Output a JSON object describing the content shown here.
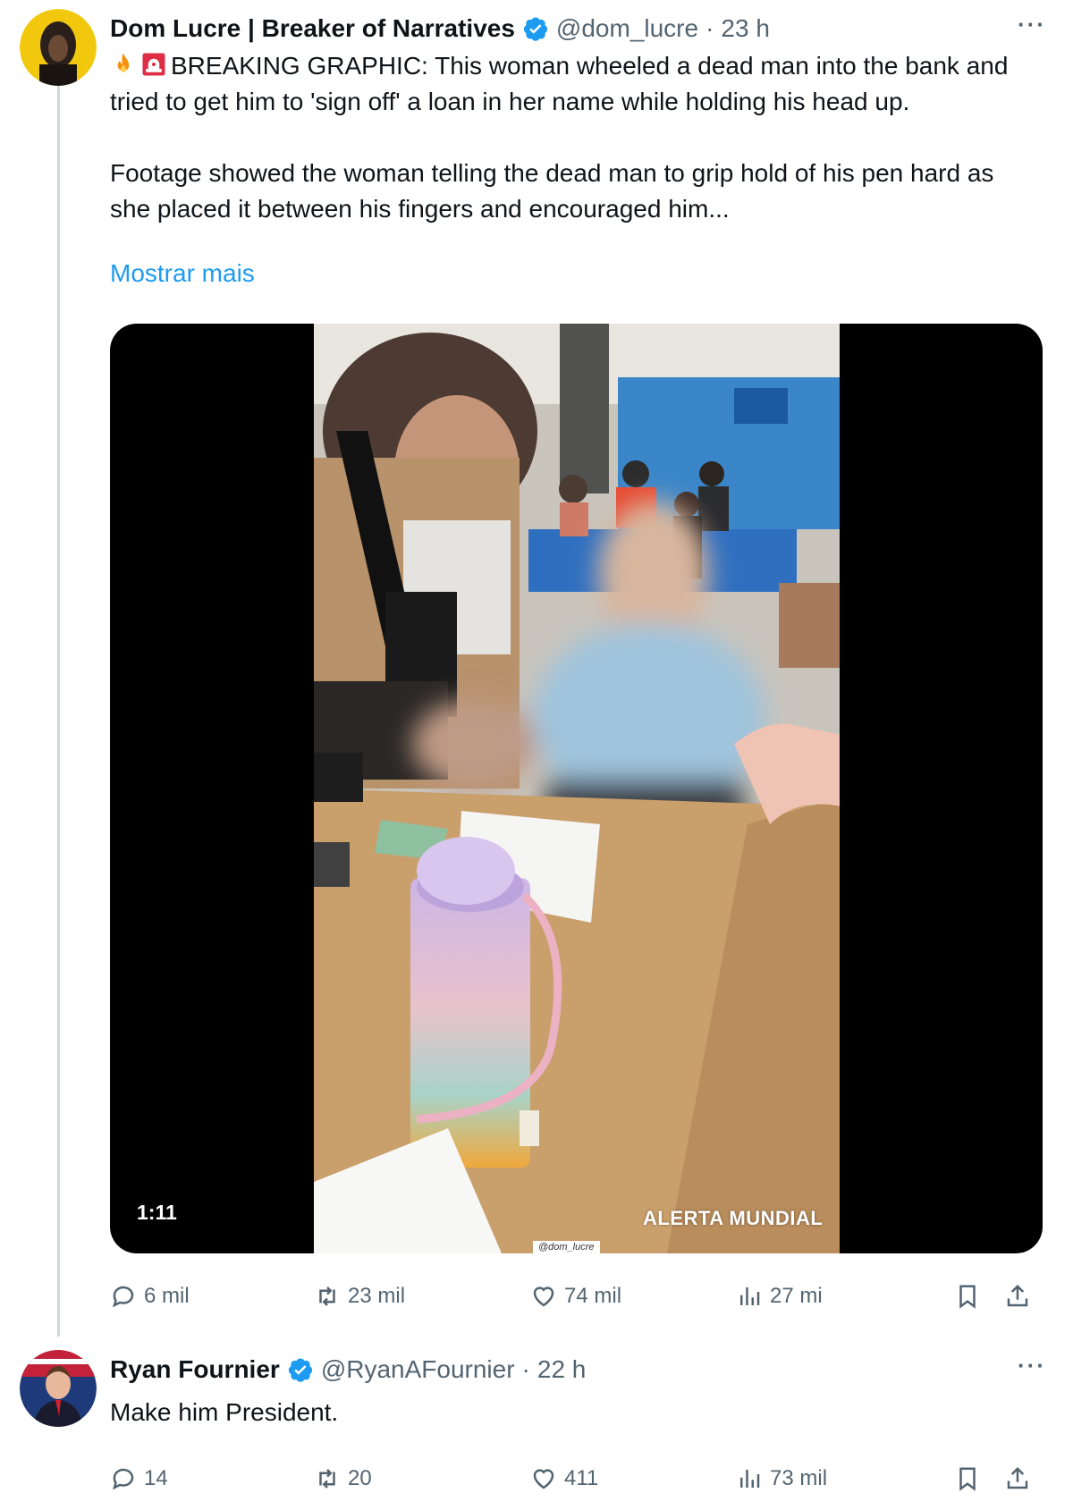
{
  "colors": {
    "accent": "#1d9bf0",
    "text_primary": "#0f1419",
    "text_secondary": "#536471",
    "thread_line": "#cfd9de"
  },
  "tweets": [
    {
      "display_name": "Dom Lucre | Breaker of Narratives",
      "handle": "@dom_lucre",
      "separator": "·",
      "time": "23 h",
      "verified_icon": "verified-badge-icon",
      "more_label": "···",
      "emoji_icons": [
        "fire-icon",
        "siren-icon"
      ],
      "paragraphs": [
        "BREAKING GRAPHIC: This woman wheeled a dead man into the bank and tried to get him to 'sign off' a loan in her name while holding his head up.",
        "Footage showed the woman telling the dead man to grip hold of his pen hard as she placed it between his fingers and encouraged him..."
      ],
      "show_more": "Mostrar mais",
      "media": {
        "duration": "1:11",
        "watermark": "ALERTA MUNDIAL",
        "watermark_handle": "@dom_lucre"
      },
      "actions": {
        "replies": "6 mil",
        "retweets": "23 mil",
        "likes": "74 mil",
        "views": "27 mi"
      }
    },
    {
      "display_name": "Ryan Fournier",
      "handle": "@RyanAFournier",
      "separator": "·",
      "time": "22 h",
      "verified_icon": "verified-badge-icon",
      "more_label": "···",
      "text": "Make him President.",
      "actions": {
        "replies": "14",
        "retweets": "20",
        "likes": "411",
        "views": "73 mil"
      }
    }
  ]
}
